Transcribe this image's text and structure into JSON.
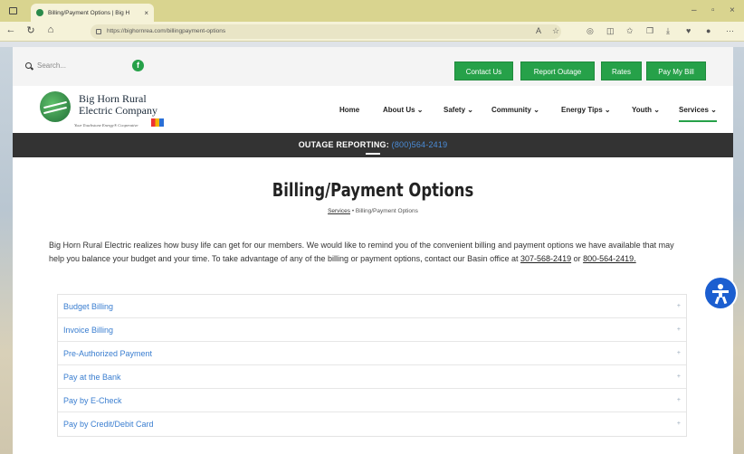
{
  "browser": {
    "tab_title": "Billing/Payment Options | Big H",
    "url": "https://bighornrea.com/billingpayment-options"
  },
  "topbar": {
    "search_placeholder": "Search...",
    "buttons": [
      "Contact Us",
      "Report Outage",
      "Rates",
      "Pay My Bill"
    ]
  },
  "header": {
    "logo_name_line1": "Big Horn Rural",
    "logo_name_line2": "Electric Company",
    "logo_tagline": "Your Touchstone Energy® Cooperative",
    "nav": [
      "Home",
      "About Us ⌄",
      "Safety ⌄",
      "Community ⌄",
      "Energy Tips ⌄",
      "Youth ⌄",
      "Services ⌄"
    ]
  },
  "outage": {
    "label": "OUTAGE REPORTING:",
    "phone": "(800)564-2419"
  },
  "main": {
    "title": "Billing/Payment Options",
    "breadcrumb_parent": "Services",
    "breadcrumb_sep": "•",
    "breadcrumb_current": "Billing/Payment Options",
    "intro_text": "Big Horn Rural Electric realizes how busy life can get for our members. We would like to remind you of the convenient billing and payment options we have available that may help you balance your budget and your time. To take advantage of any of the billing or payment options, contact our Basin office at",
    "phone1": "307-568-2419",
    "or": "or",
    "phone2": "800-564-2419.",
    "accordion": [
      "Budget Billing",
      "Invoice Billing",
      "Pre-Authorized Payment",
      "Pay at the Bank",
      "Pay by E-Check",
      "Pay by Credit/Debit Card"
    ]
  },
  "colors": {
    "brand_green": "#26a149",
    "link_blue": "#3a7ed0",
    "outage_bar": "#333333",
    "accessibility_blue": "#1b5ed0"
  }
}
